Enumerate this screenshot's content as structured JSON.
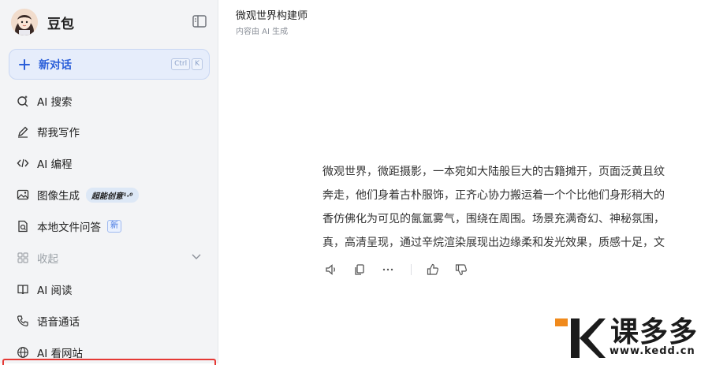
{
  "sidebar": {
    "brand_name": "豆包",
    "new_chat_label": "新对话",
    "shortcut_keys": [
      "Ctrl",
      "K"
    ],
    "items": [
      {
        "label": "AI 搜索",
        "icon": "search-sparkle-icon"
      },
      {
        "label": "帮我写作",
        "icon": "pen-icon"
      },
      {
        "label": "AI 编程",
        "icon": "code-icon"
      },
      {
        "label": "图像生成",
        "icon": "image-icon",
        "badge": "超能创意¹·⁰"
      },
      {
        "label": "本地文件问答",
        "icon": "file-search-icon",
        "badge": "新"
      },
      {
        "label": "收起",
        "icon": "grid-icon"
      },
      {
        "label": "AI 阅读",
        "icon": "book-icon"
      },
      {
        "label": "语音通话",
        "icon": "phone-icon"
      },
      {
        "label": "AI 看网站",
        "icon": "globe-icon"
      }
    ]
  },
  "main": {
    "title": "微观世界构建师",
    "subtitle": "内容由 AI 生成",
    "message_lines": [
      "微观世界，微距摄影，一本宛如大陆般巨大的古籍摊开，页面泛黄且纹",
      "奔走，他们身着古朴服饰，正齐心协力搬运着一个个比他们身形稍大的",
      "香仿佛化为可见的氤氲雾气，围绕在周围。场景充满奇幻、神秘氛围，",
      "真，高清呈现，通过辛烷渲染展现出边缘柔和发光效果，质感十足，文"
    ]
  },
  "watermark": {
    "text": "课多多",
    "url": "www.kedd.cn"
  },
  "colors": {
    "accent": "#2b5fd9",
    "sidebar_bg": "#f3f4f6",
    "watermark_orange": "#f08a1c",
    "highlight_red": "#e53935"
  }
}
